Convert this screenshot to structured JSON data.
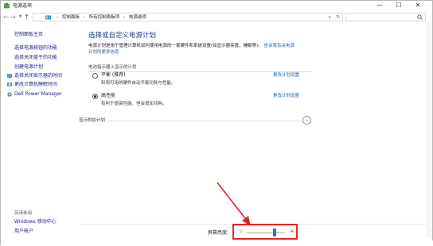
{
  "window": {
    "title": "电源选项",
    "minimize_glyph": "—",
    "maximize_glyph": "☐",
    "close_glyph": "✕"
  },
  "address": {
    "breadcrumbs": [
      "控制面板",
      "所有控制面板项",
      "电源选项"
    ],
    "separator": "›"
  },
  "sidebar": {
    "home": "控制面板主页",
    "items": [
      {
        "label": "选择电源按钮的功能",
        "icon": null
      },
      {
        "label": "选择关闭盖子的功能",
        "icon": null
      },
      {
        "label": "创建电源计划",
        "icon": null
      },
      {
        "label": "选择关闭显示器的时间",
        "icon": "monitor-icon"
      },
      {
        "label": "更改计算机睡眠时间",
        "icon": "moon-icon"
      },
      {
        "label": "Dell Power Manager",
        "icon": "dell-icon"
      }
    ],
    "see_also_heading": "另请参阅",
    "see_also": [
      "Windows 移动中心",
      "用户帐户"
    ]
  },
  "main": {
    "heading": "选择或自定义电源计划",
    "description": "电源计划是用于管理计算机如何使用电源的一套硬件和系统设置(如显示器亮度、睡眠等)。",
    "more_link": "告诉我有关电源计划的更多信息",
    "section_label": "电池指示器上显示的计划",
    "plans": [
      {
        "name": "平衡 (推荐)",
        "desc": "利用可用的硬件自动平衡功耗与性能。",
        "change": "更改计划设置",
        "selected": false
      },
      {
        "name": "高性能",
        "desc": "有利于提高性能，但会增加功耗。",
        "change": "更改计划设置",
        "selected": true
      }
    ],
    "more_plans_label": "显示附加计划",
    "more_plans_chevron": "⌄"
  },
  "bottom": {
    "brightness_label": "屏幕亮度:",
    "brightness_level": 0.72
  },
  "colors": {
    "accent": "#2a6fd6",
    "highlight_border": "#e22222",
    "link": "#1a5fb4",
    "heading": "#1e3e8c"
  }
}
